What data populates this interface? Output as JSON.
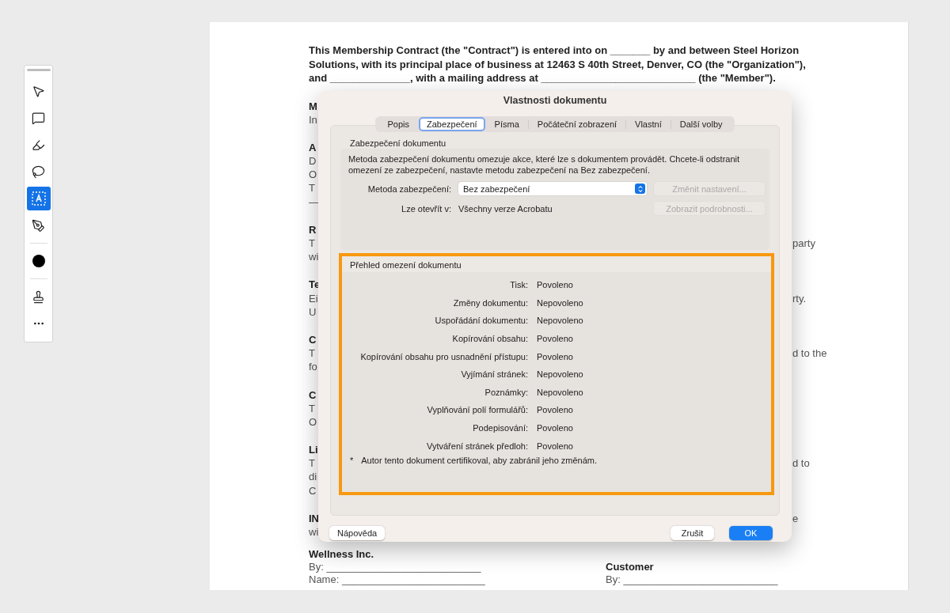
{
  "toolbar": [
    {
      "kind": "tool",
      "selected": false
    },
    {
      "kind": "tool",
      "selected": false
    },
    {
      "kind": "tool",
      "selected": false
    },
    {
      "kind": "tool",
      "selected": false
    },
    {
      "kind": "tool",
      "selected": true
    },
    {
      "kind": "tool",
      "selected": false
    },
    {
      "kind": "color",
      "color": "#000000"
    },
    {
      "kind": "tool",
      "selected": false
    },
    {
      "kind": "more"
    }
  ],
  "document": {
    "intro": [
      "This Membership Contract (the \"Contract\") is entered into on _______ by and between Steel Horizon",
      "Solutions, with its principal place of business at 12463 S 40th Street, Denver, CO (the \"Organization\"),",
      "and ______________, with a mailing address at ___________________________ (the \"Member\")."
    ],
    "blocks": [
      {
        "lines": [
          {
            "left": "M"
          },
          {
            "left": "In"
          }
        ]
      },
      {
        "lines": [
          {
            "left": "A"
          },
          {
            "left": "D"
          },
          {
            "left": "O"
          },
          {
            "left": "T"
          },
          {
            "left": "—"
          }
        ]
      },
      {
        "lines": [
          {
            "left": "R"
          },
          {
            "left": "T",
            "right": "party"
          },
          {
            "left": "wi"
          }
        ]
      },
      {
        "lines": [
          {
            "left": "Te"
          },
          {
            "left": "Ei",
            "right": "rty."
          },
          {
            "left": "U"
          }
        ]
      },
      {
        "lines": [
          {
            "left": "C"
          },
          {
            "left": "T",
            "right": "d to the"
          },
          {
            "left": "fo"
          }
        ]
      },
      {
        "lines": [
          {
            "left": "C"
          },
          {
            "left": "T"
          },
          {
            "left": "O"
          }
        ]
      },
      {
        "lines": [
          {
            "left": "Li"
          },
          {
            "left": "T",
            "right": "d to"
          },
          {
            "left": "di"
          },
          {
            "left": "C"
          }
        ]
      },
      {
        "lines": [
          {
            "left": "IN",
            "right": "e"
          },
          {
            "left": "wi"
          }
        ]
      }
    ],
    "signatures": [
      {
        "heading": "Wellness Inc.",
        "lines": [
          "By: ___________________________",
          "Name: _________________________"
        ]
      },
      {
        "heading": "Customer",
        "lines": [
          "By: ___________________________"
        ]
      }
    ]
  },
  "dialog": {
    "title": "Vlastnosti dokumentu",
    "tabs": [
      {
        "label": "Popis",
        "selected": false
      },
      {
        "label": "Zabezpečení",
        "selected": true
      },
      {
        "label": "Písma",
        "selected": false
      },
      {
        "label": "Počáteční zobrazení",
        "selected": false
      },
      {
        "label": "Vlastní",
        "selected": false
      },
      {
        "label": "Další volby",
        "selected": false
      }
    ],
    "security": {
      "title": "Zabezpečení dokumentu",
      "description": "Metoda zabezpečení dokumentu omezuje akce, které lze s dokumentem provádět. Chcete-li odstranit omezení ze zabezpečení, nastavte metodu zabezpečení na Bez zabezpečení.",
      "method_label": "Metoda zabezpečení:",
      "method_value": "Bez zabezpečení",
      "change_button": {
        "label": "Změnit nastavení...",
        "disabled": true
      },
      "open_label": "Lze otevřít v:",
      "open_value": "Všechny verze Acrobatu",
      "details_button": {
        "label": "Zobrazit podrobnosti...",
        "disabled": true
      }
    },
    "restrictions": {
      "title": "Přehled omezení dokumentu",
      "rows": [
        {
          "label": "Tisk:",
          "value": "Povoleno"
        },
        {
          "label": "Změny dokumentu:",
          "value": "Nepovoleno"
        },
        {
          "label": "Uspořádání dokumentu:",
          "value": "Nepovoleno"
        },
        {
          "label": "Kopírování obsahu:",
          "value": "Povoleno"
        },
        {
          "label": "Kopírování obsahu pro usnadnění přístupu:",
          "value": "Povoleno"
        },
        {
          "label": "Vyjímání stránek:",
          "value": "Nepovoleno"
        },
        {
          "label": "Poznámky:",
          "value": "Nepovoleno"
        },
        {
          "label": "Vyplňování polí formulářů:",
          "value": "Povoleno"
        },
        {
          "label": "Podepisování:",
          "value": "Povoleno"
        },
        {
          "label": "Vytváření stránek předloh:",
          "value": "Povoleno"
        }
      ],
      "note_bullet": "*",
      "note": "Autor tento dokument certifikoval, aby zabránil jeho změnám."
    },
    "buttons": {
      "help": "Nápověda",
      "cancel": "Zrušit",
      "ok": "OK"
    }
  }
}
